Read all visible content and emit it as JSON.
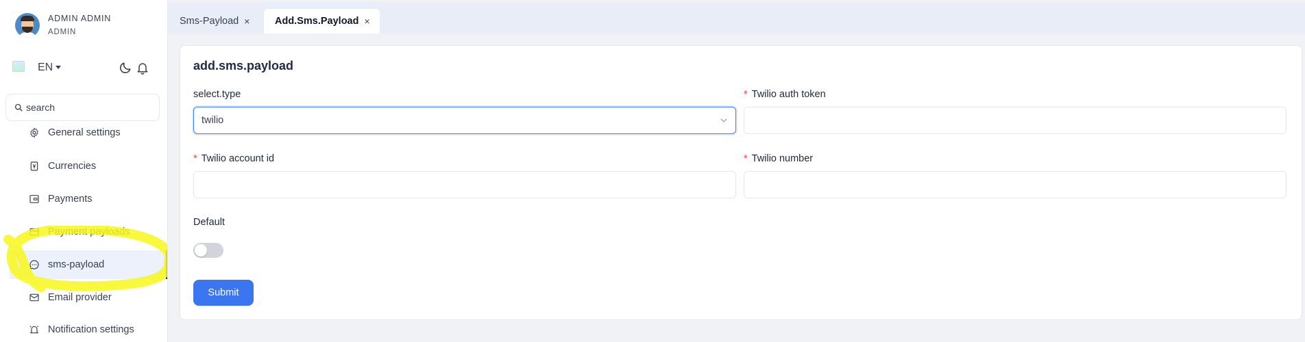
{
  "user": {
    "name": "ADMIN ADMIN",
    "role": "ADMIN"
  },
  "toolbar": {
    "language": "EN"
  },
  "search": {
    "placeholder": "search",
    "value": ""
  },
  "sidebar": {
    "items": [
      {
        "label": "General settings",
        "icon": "gear-icon"
      },
      {
        "label": "Currencies",
        "icon": "currency-icon"
      },
      {
        "label": "Payments",
        "icon": "wallet-icon"
      },
      {
        "label": "Payment payloads",
        "icon": "credit-card-icon"
      },
      {
        "label": "sms-payload",
        "icon": "chat-bubble-icon",
        "active": true
      },
      {
        "label": "Email provider",
        "icon": "mail-icon"
      },
      {
        "label": "Notification settings",
        "icon": "bell-ring-icon"
      }
    ]
  },
  "tabs": [
    {
      "label": "Sms-Payload",
      "close": "×"
    },
    {
      "label": "Add.Sms.Payload",
      "close": "×",
      "active": true
    }
  ],
  "form": {
    "title": "add.sms.payload",
    "select_type_label": "select.type",
    "select_type_value": "twilio",
    "auth_token_label": "Twilio auth token",
    "account_id_label": "Twilio account id",
    "number_label": "Twilio number",
    "required_mark": "*",
    "default_label": "Default",
    "default_value": false,
    "submit_label": "Submit"
  },
  "colors": {
    "accent": "#3b76f0",
    "required": "#ef4444",
    "active_nav_bg": "#edf1fb",
    "highlighter": "#f7f71a"
  }
}
